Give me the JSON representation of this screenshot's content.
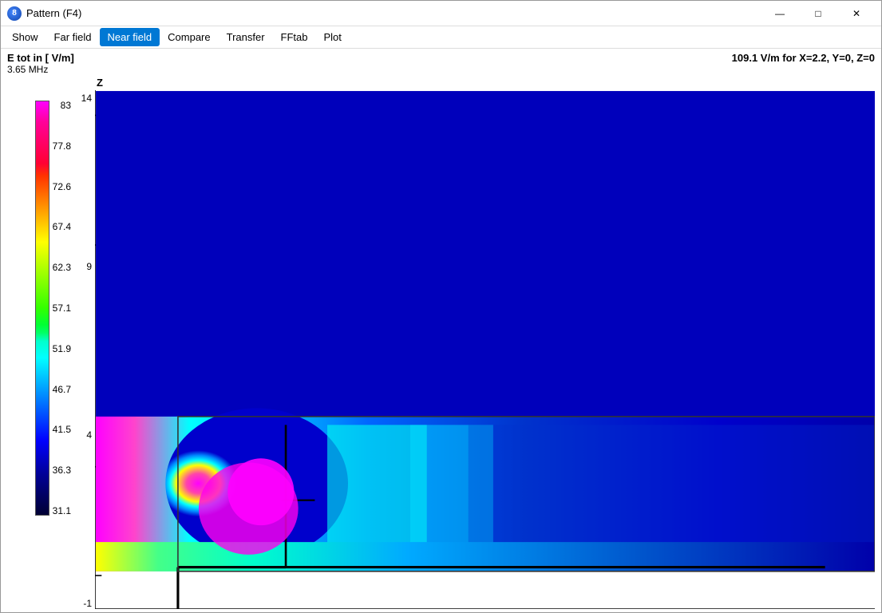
{
  "window": {
    "title": "Pattern  (F4)",
    "icon": "8"
  },
  "window_controls": {
    "minimize": "—",
    "maximize": "□",
    "close": "✕"
  },
  "menu": {
    "items": [
      {
        "label": "Show",
        "active": false
      },
      {
        "label": "Far field",
        "active": false
      },
      {
        "label": "Near field",
        "active": true
      },
      {
        "label": "Compare",
        "active": false
      },
      {
        "label": "Transfer",
        "active": false
      },
      {
        "label": "FFtab",
        "active": false
      },
      {
        "label": "Plot",
        "active": false
      }
    ]
  },
  "info": {
    "label": "E tot in [ V/m]",
    "frequency": "3.65 MHz",
    "reading": "109.1  V/m for X=2.2, Y=0, Z=0"
  },
  "colorbar": {
    "values": [
      "83",
      "77.8",
      "72.6",
      "67.4",
      "62.3",
      "57.1",
      "51.9",
      "46.7",
      "41.5",
      "36.3",
      "31.1"
    ]
  },
  "y_axis": {
    "label": "Z",
    "values": [
      "14",
      "9",
      "4",
      "-1"
    ]
  }
}
